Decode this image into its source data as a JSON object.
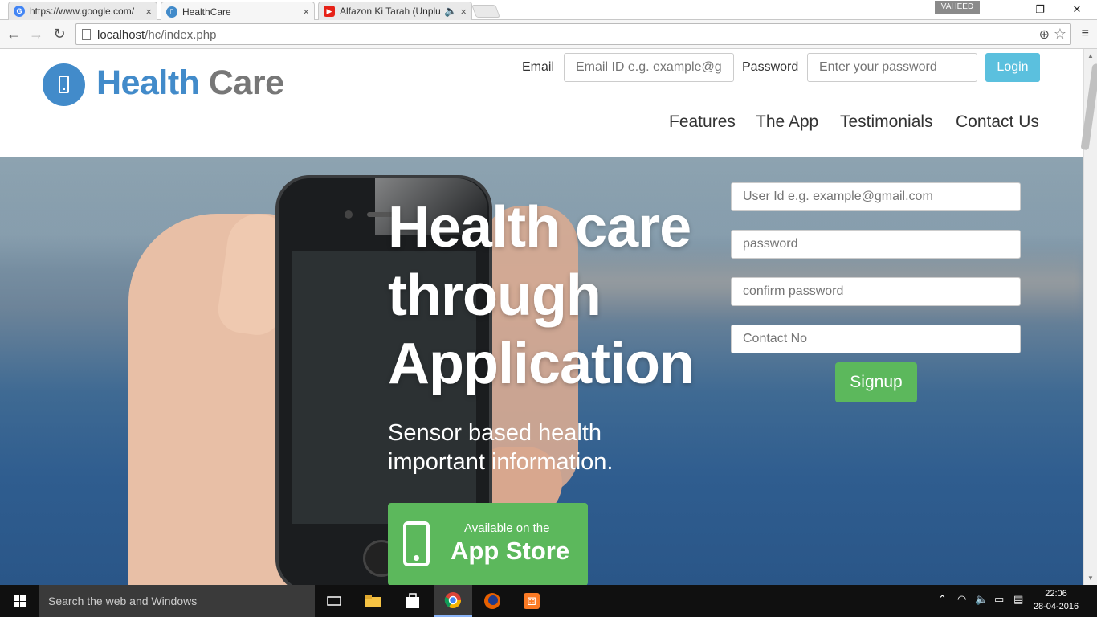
{
  "browser": {
    "tabs": [
      {
        "title": "https://www.google.com/",
        "favicon": "google-icon"
      },
      {
        "title": "HealthCare",
        "favicon": "healthcare-icon"
      },
      {
        "title": "Alfazon Ki Tarah (Unplu",
        "favicon": "youtube-icon"
      }
    ],
    "close_glyph": "×",
    "profile_name": "VAHEED",
    "url_host": "localhost",
    "url_path": "/hc/index.php",
    "min_glyph": "—",
    "max_glyph": "❐",
    "close_window_glyph": "✕"
  },
  "header": {
    "brand_first": "Health",
    "brand_second": "Care",
    "email_label": "Email",
    "email_placeholder": "Email ID e.g. example@gmail.com",
    "password_label": "Password",
    "password_placeholder": "Enter your password",
    "login_label": "Login",
    "nav": [
      "Features",
      "The App",
      "Testimonials",
      "Contact Us"
    ]
  },
  "hero": {
    "headline": "Health care through Application",
    "subline": "Sensor based health important information.",
    "appstore_small": "Available on the",
    "appstore_big": "App Store",
    "form": {
      "userid_placeholder": "User Id e.g. example@gmail.com",
      "password_placeholder": "password",
      "confirm_placeholder": "confirm password",
      "contact_placeholder": "Contact No",
      "signup_label": "Signup"
    }
  },
  "taskbar": {
    "search_text": "Search the web and Windows",
    "time": "22:06",
    "date": "28-04-2016"
  },
  "colors": {
    "brand_blue": "#428bca",
    "login_btn": "#5bc0de",
    "green_btn": "#5cb85c"
  }
}
